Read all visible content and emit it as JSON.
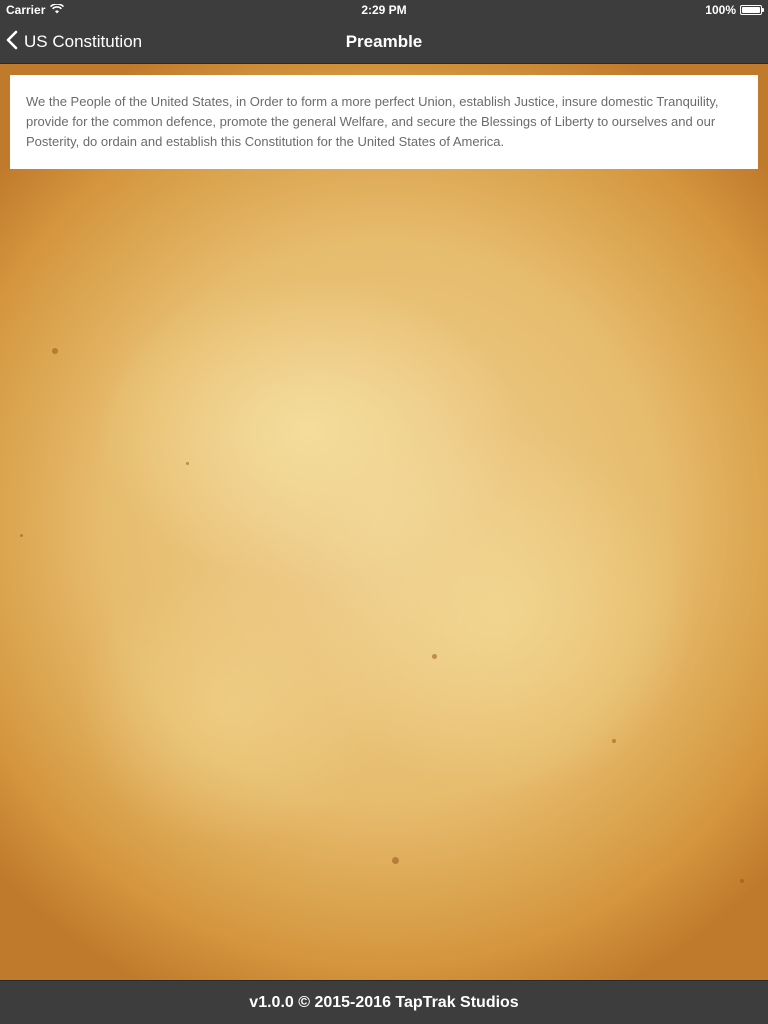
{
  "status_bar": {
    "carrier": "Carrier",
    "time": "2:29 PM",
    "battery_percent": "100%",
    "battery_level": 1.0,
    "wifi_icon": "wifi-icon",
    "battery_icon": "battery-icon"
  },
  "nav": {
    "back_label": "US Constitution",
    "back_icon": "chevron-left-icon",
    "title": "Preamble"
  },
  "preamble": {
    "text": "We the People of the United States, in Order to form a more perfect Union, establish Justice, insure domestic Tranquility, provide for the common defence, promote the general Welfare, and secure the Blessings of Liberty to ourselves and our Posterity, do ordain and establish this Constitution for the United States of America."
  },
  "footer": {
    "text": "v1.0.0 © 2015-2016 TapTrak Studios"
  },
  "colors": {
    "bar_background": "#3d3d3d",
    "card_background": "#ffffff",
    "body_text": "#6b6b6b",
    "parchment": "#e6bb6c"
  }
}
